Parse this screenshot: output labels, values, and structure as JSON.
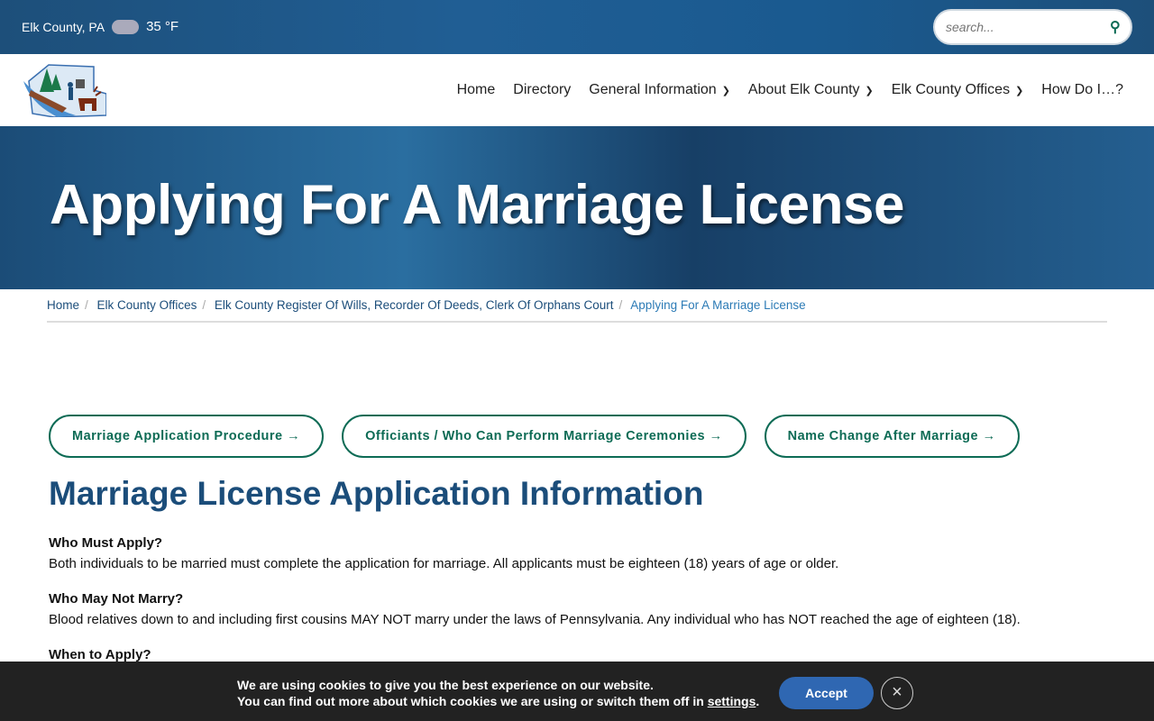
{
  "topbar": {
    "location": "Elk County, PA",
    "weather_icon": "cloud-icon",
    "temperature": "35 °F",
    "search_placeholder": "search..."
  },
  "nav": {
    "items": [
      {
        "label": "Home"
      },
      {
        "label": "Directory"
      },
      {
        "label": "General Information",
        "dropdown": true
      },
      {
        "label": "About Elk County",
        "dropdown": true
      },
      {
        "label": "Elk County Offices",
        "dropdown": true
      },
      {
        "label": "How Do I…?"
      }
    ]
  },
  "hero": {
    "title": "Applying For A Marriage License"
  },
  "breadcrumb": [
    "Home",
    "Elk County Offices",
    "Elk County Register Of Wills, Recorder Of Deeds, Clerk Of Orphans Court",
    "Applying For A Marriage License"
  ],
  "buttons": [
    "Marriage Application Procedure →",
    "Officiants / Who Can Perform Marriage Ceremonies →",
    "Name Change After Marriage →"
  ],
  "main": {
    "heading": "Marriage License Application Information",
    "sections": [
      {
        "q": "Who Must Apply?",
        "a": "Both individuals to be married must complete the application for marriage. All applicants must be eighteen (18) years of age or older."
      },
      {
        "q": "Who May Not Marry?",
        "a": "Blood relatives down to and including first cousins MAY NOT marry under the laws of Pennsylvania. Any individual who has NOT reached the age of eighteen (18)."
      },
      {
        "q": "When to Apply?",
        "a": ""
      }
    ]
  },
  "cookie": {
    "line1": "We are using cookies to give you the best experience on our website.",
    "line2": "You can find out more about which cookies we are using or switch them off in ",
    "link": "settings",
    "end": ".",
    "accept": "Accept",
    "close": "×"
  },
  "colors": {
    "accent": "#0d6b55",
    "heading": "#1b4d7a",
    "accept": "#2f67b2"
  }
}
